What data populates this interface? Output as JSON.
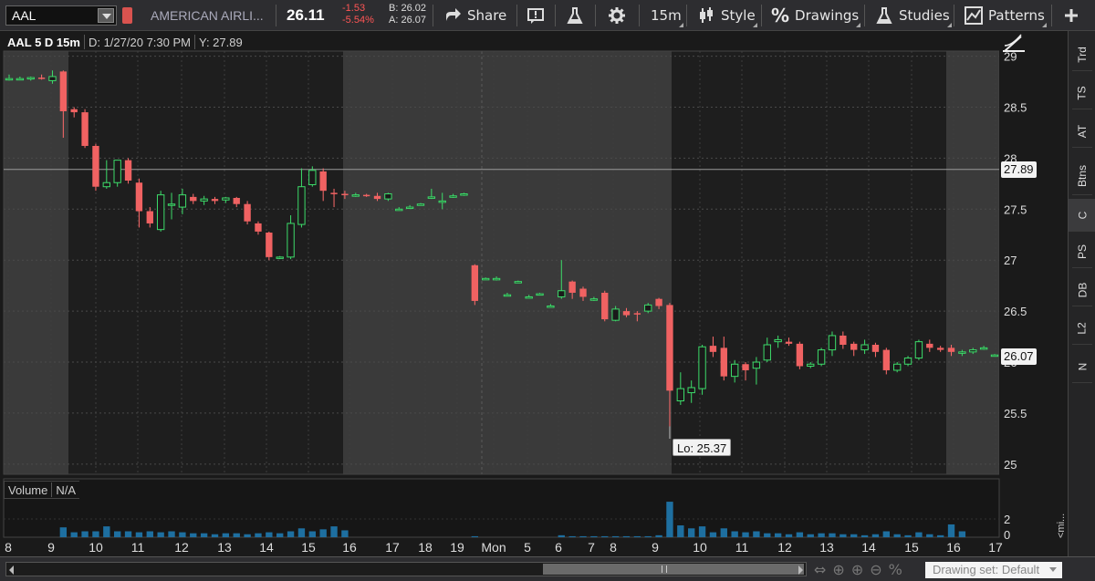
{
  "toolbar": {
    "symbol": "AAL",
    "company": "AMERICAN AIRLI...",
    "last": "26.11",
    "change": "-1.53",
    "change_pct": "-5.54%",
    "bid": "B: 26.02",
    "ask": "A: 26.07",
    "share_label": "Share",
    "timeframe_label": "15m",
    "style_label": "Style",
    "drawings_label": "Drawings",
    "studies_label": "Studies",
    "patterns_label": "Patterns"
  },
  "chart_header": {
    "title": "AAL 5 D 15m",
    "date": "D: 1/27/20 7:30 PM",
    "y": "Y: 27.89"
  },
  "volume_header": {
    "label": "Volume",
    "value": "N/A"
  },
  "price_tags": {
    "crosshair": "27.89",
    "last": "26.07",
    "low": "Lo: 25.37"
  },
  "side_tabs": [
    "Trd",
    "TS",
    "AT",
    "Btns",
    "C",
    "PS",
    "DB",
    "L2",
    "N"
  ],
  "bottom": {
    "drawing_set": "Drawing set: Default",
    "mini_label": "<mi..."
  },
  "colors": {
    "up": "#22c55e",
    "down": "#f06262",
    "session_light": "#3a3a3a",
    "session_dark": "#1e1e1e"
  },
  "chart_data": {
    "type": "candlestick",
    "title": "AAL 5 D 15m",
    "ylim": [
      24.9,
      29.05
    ],
    "y_ticks": [
      "29",
      "28.5",
      "28",
      "27.5",
      "27",
      "26.5",
      "26",
      "25.5",
      "25"
    ],
    "x_ticks": [
      "8",
      "9",
      "10",
      "11",
      "12",
      "13",
      "14",
      "15",
      "16",
      "17",
      "18",
      "19",
      "Mon",
      "5",
      "6",
      "7",
      "8",
      "9",
      "10",
      "11",
      "12",
      "13",
      "14",
      "15",
      "16",
      "17"
    ],
    "volume_ticks": [
      "2",
      "0"
    ],
    "crosshair_y": 27.89,
    "low": 25.37,
    "last": 26.07,
    "candles": [
      {
        "o": 28.78,
        "h": 28.82,
        "l": 28.76,
        "c": 28.78
      },
      {
        "o": 28.78,
        "h": 28.8,
        "l": 28.77,
        "c": 28.78
      },
      {
        "o": 28.78,
        "h": 28.8,
        "l": 28.76,
        "c": 28.79
      },
      {
        "o": 28.79,
        "h": 28.82,
        "l": 28.77,
        "c": 28.78
      },
      {
        "o": 28.76,
        "h": 28.86,
        "l": 28.73,
        "c": 28.8
      },
      {
        "o": 28.85,
        "h": 28.86,
        "l": 28.2,
        "c": 28.46
      },
      {
        "o": 28.48,
        "h": 28.5,
        "l": 28.4,
        "c": 28.45
      },
      {
        "o": 28.45,
        "h": 28.48,
        "l": 28.1,
        "c": 28.12
      },
      {
        "o": 28.12,
        "h": 28.14,
        "l": 27.68,
        "c": 27.72
      },
      {
        "o": 27.72,
        "h": 27.98,
        "l": 27.7,
        "c": 27.76
      },
      {
        "o": 27.76,
        "h": 27.98,
        "l": 27.72,
        "c": 27.98
      },
      {
        "o": 27.98,
        "h": 28.0,
        "l": 27.75,
        "c": 27.78
      },
      {
        "o": 27.76,
        "h": 27.8,
        "l": 27.32,
        "c": 27.48
      },
      {
        "o": 27.48,
        "h": 27.52,
        "l": 27.32,
        "c": 27.36
      },
      {
        "o": 27.3,
        "h": 27.68,
        "l": 27.28,
        "c": 27.64
      },
      {
        "o": 27.54,
        "h": 27.66,
        "l": 27.4,
        "c": 27.55
      },
      {
        "o": 27.52,
        "h": 27.7,
        "l": 27.45,
        "c": 27.64
      },
      {
        "o": 27.62,
        "h": 27.65,
        "l": 27.55,
        "c": 27.58
      },
      {
        "o": 27.58,
        "h": 27.63,
        "l": 27.54,
        "c": 27.6
      },
      {
        "o": 27.6,
        "h": 27.62,
        "l": 27.55,
        "c": 27.58
      },
      {
        "o": 27.59,
        "h": 27.62,
        "l": 27.56,
        "c": 27.61
      },
      {
        "o": 27.61,
        "h": 27.62,
        "l": 27.52,
        "c": 27.55
      },
      {
        "o": 27.55,
        "h": 27.58,
        "l": 27.35,
        "c": 27.38
      },
      {
        "o": 27.36,
        "h": 27.38,
        "l": 27.25,
        "c": 27.28
      },
      {
        "o": 27.27,
        "h": 27.28,
        "l": 27.0,
        "c": 27.03
      },
      {
        "o": 27.02,
        "h": 27.04,
        "l": 27.01,
        "c": 27.03
      },
      {
        "o": 27.03,
        "h": 27.44,
        "l": 27.01,
        "c": 27.36
      },
      {
        "o": 27.35,
        "h": 27.9,
        "l": 27.32,
        "c": 27.72
      },
      {
        "o": 27.74,
        "h": 27.92,
        "l": 27.72,
        "c": 27.88
      },
      {
        "o": 27.87,
        "h": 27.9,
        "l": 27.58,
        "c": 27.68
      },
      {
        "o": 27.66,
        "h": 27.7,
        "l": 27.52,
        "c": 27.65
      },
      {
        "o": 27.65,
        "h": 27.68,
        "l": 27.6,
        "c": 27.64
      },
      {
        "o": 27.64,
        "h": 27.66,
        "l": 27.62,
        "c": 27.64
      },
      {
        "o": 27.64,
        "h": 27.65,
        "l": 27.62,
        "c": 27.63
      },
      {
        "o": 27.63,
        "h": 27.66,
        "l": 27.58,
        "c": 27.6
      },
      {
        "o": 27.6,
        "h": 27.66,
        "l": 27.58,
        "c": 27.65
      },
      {
        "o": 27.5,
        "h": 27.52,
        "l": 27.49,
        "c": 27.5
      },
      {
        "o": 27.52,
        "h": 27.54,
        "l": 27.51,
        "c": 27.52
      },
      {
        "o": 27.55,
        "h": 27.56,
        "l": 27.54,
        "c": 27.55
      },
      {
        "o": 27.62,
        "h": 27.7,
        "l": 27.6,
        "c": 27.62
      },
      {
        "o": 27.58,
        "h": 27.66,
        "l": 27.5,
        "c": 27.58
      },
      {
        "o": 27.62,
        "h": 27.65,
        "l": 27.61,
        "c": 27.63
      },
      {
        "o": 27.64,
        "h": 27.66,
        "l": 27.63,
        "c": 27.65
      },
      {
        "o": 26.95,
        "h": 26.96,
        "l": 26.56,
        "c": 26.6
      },
      {
        "o": 26.82,
        "h": 26.83,
        "l": 26.81,
        "c": 26.82
      },
      {
        "o": 26.82,
        "h": 26.84,
        "l": 26.8,
        "c": 26.82
      },
      {
        "o": 26.66,
        "h": 26.68,
        "l": 26.65,
        "c": 26.66
      },
      {
        "o": 26.79,
        "h": 26.8,
        "l": 26.78,
        "c": 26.79
      },
      {
        "o": 26.64,
        "h": 26.66,
        "l": 26.63,
        "c": 26.64
      },
      {
        "o": 26.67,
        "h": 26.68,
        "l": 26.66,
        "c": 26.67
      },
      {
        "o": 26.55,
        "h": 26.57,
        "l": 26.54,
        "c": 26.55
      },
      {
        "o": 26.64,
        "h": 27.0,
        "l": 26.62,
        "c": 26.7
      },
      {
        "o": 26.79,
        "h": 26.8,
        "l": 26.62,
        "c": 26.68
      },
      {
        "o": 26.72,
        "h": 26.74,
        "l": 26.6,
        "c": 26.64
      },
      {
        "o": 26.62,
        "h": 26.64,
        "l": 26.6,
        "c": 26.62
      },
      {
        "o": 26.68,
        "h": 26.7,
        "l": 26.4,
        "c": 26.42
      },
      {
        "o": 26.41,
        "h": 26.55,
        "l": 26.4,
        "c": 26.52
      },
      {
        "o": 26.5,
        "h": 26.53,
        "l": 26.44,
        "c": 26.46
      },
      {
        "o": 26.48,
        "h": 26.5,
        "l": 26.4,
        "c": 26.47
      },
      {
        "o": 26.5,
        "h": 26.58,
        "l": 26.48,
        "c": 26.56
      },
      {
        "o": 26.62,
        "h": 26.63,
        "l": 26.52,
        "c": 26.55
      },
      {
        "o": 26.56,
        "h": 26.58,
        "l": 25.37,
        "c": 25.72
      },
      {
        "o": 25.62,
        "h": 25.9,
        "l": 25.58,
        "c": 25.74
      },
      {
        "o": 25.7,
        "h": 25.82,
        "l": 25.6,
        "c": 25.75
      },
      {
        "o": 25.74,
        "h": 26.17,
        "l": 25.68,
        "c": 26.15
      },
      {
        "o": 26.16,
        "h": 26.25,
        "l": 26.05,
        "c": 26.1
      },
      {
        "o": 26.14,
        "h": 26.25,
        "l": 25.82,
        "c": 25.86
      },
      {
        "o": 25.86,
        "h": 26.02,
        "l": 25.8,
        "c": 25.98
      },
      {
        "o": 25.98,
        "h": 26.0,
        "l": 25.82,
        "c": 25.92
      },
      {
        "o": 25.94,
        "h": 26.05,
        "l": 25.78,
        "c": 26.0
      },
      {
        "o": 26.02,
        "h": 26.24,
        "l": 26.0,
        "c": 26.17
      },
      {
        "o": 26.2,
        "h": 26.26,
        "l": 26.14,
        "c": 26.22
      },
      {
        "o": 26.2,
        "h": 26.24,
        "l": 26.16,
        "c": 26.18
      },
      {
        "o": 26.18,
        "h": 26.2,
        "l": 25.93,
        "c": 25.96
      },
      {
        "o": 25.96,
        "h": 26.0,
        "l": 25.94,
        "c": 25.98
      },
      {
        "o": 25.98,
        "h": 26.14,
        "l": 25.96,
        "c": 26.12
      },
      {
        "o": 26.12,
        "h": 26.3,
        "l": 26.06,
        "c": 26.26
      },
      {
        "o": 26.26,
        "h": 26.3,
        "l": 26.13,
        "c": 26.17
      },
      {
        "o": 26.18,
        "h": 26.2,
        "l": 26.06,
        "c": 26.12
      },
      {
        "o": 26.12,
        "h": 26.22,
        "l": 26.08,
        "c": 26.17
      },
      {
        "o": 26.17,
        "h": 26.19,
        "l": 26.05,
        "c": 26.1
      },
      {
        "o": 26.12,
        "h": 26.14,
        "l": 25.88,
        "c": 25.92
      },
      {
        "o": 25.92,
        "h": 26.0,
        "l": 25.9,
        "c": 25.98
      },
      {
        "o": 25.98,
        "h": 26.06,
        "l": 25.96,
        "c": 26.04
      },
      {
        "o": 26.04,
        "h": 26.22,
        "l": 26.02,
        "c": 26.2
      },
      {
        "o": 26.18,
        "h": 26.22,
        "l": 26.1,
        "c": 26.14
      },
      {
        "o": 26.14,
        "h": 26.16,
        "l": 26.1,
        "c": 26.12
      },
      {
        "o": 26.14,
        "h": 26.17,
        "l": 26.06,
        "c": 26.1
      },
      {
        "o": 26.1,
        "h": 26.12,
        "l": 26.06,
        "c": 26.1
      },
      {
        "o": 26.1,
        "h": 26.14,
        "l": 26.08,
        "c": 26.12
      },
      {
        "o": 26.13,
        "h": 26.16,
        "l": 26.12,
        "c": 26.14
      },
      {
        "o": 26.07,
        "h": 26.08,
        "l": 26.06,
        "c": 26.07
      }
    ],
    "volume": [
      0,
      0,
      0,
      0,
      0,
      1,
      0.5,
      0.6,
      0.6,
      1.1,
      0.6,
      0.6,
      0.5,
      0.6,
      0.5,
      0.6,
      0.5,
      0.4,
      0.4,
      0.3,
      0.4,
      0.4,
      0.3,
      0.4,
      0.5,
      0.4,
      0.6,
      0.9,
      0.6,
      0.8,
      1.1,
      0.7,
      0,
      0,
      0,
      0,
      0,
      0,
      0,
      0,
      0,
      0,
      0,
      0.1,
      0,
      0,
      0,
      0,
      0,
      0,
      0,
      0.2,
      0.1,
      0.1,
      0.1,
      0.1,
      0.1,
      0.1,
      0.1,
      0.1,
      0.2,
      3.6,
      1.2,
      0.9,
      1.1,
      0.5,
      0.9,
      0.6,
      0.5,
      0.6,
      0.4,
      0.4,
      0.3,
      0.5,
      0.3,
      0.4,
      0.4,
      0.3,
      0.3,
      0.2,
      0.3,
      0.6,
      0.3,
      0.2,
      0.5,
      0.3,
      0.2,
      1.3,
      0.6,
      0,
      0,
      0,
      0
    ]
  }
}
